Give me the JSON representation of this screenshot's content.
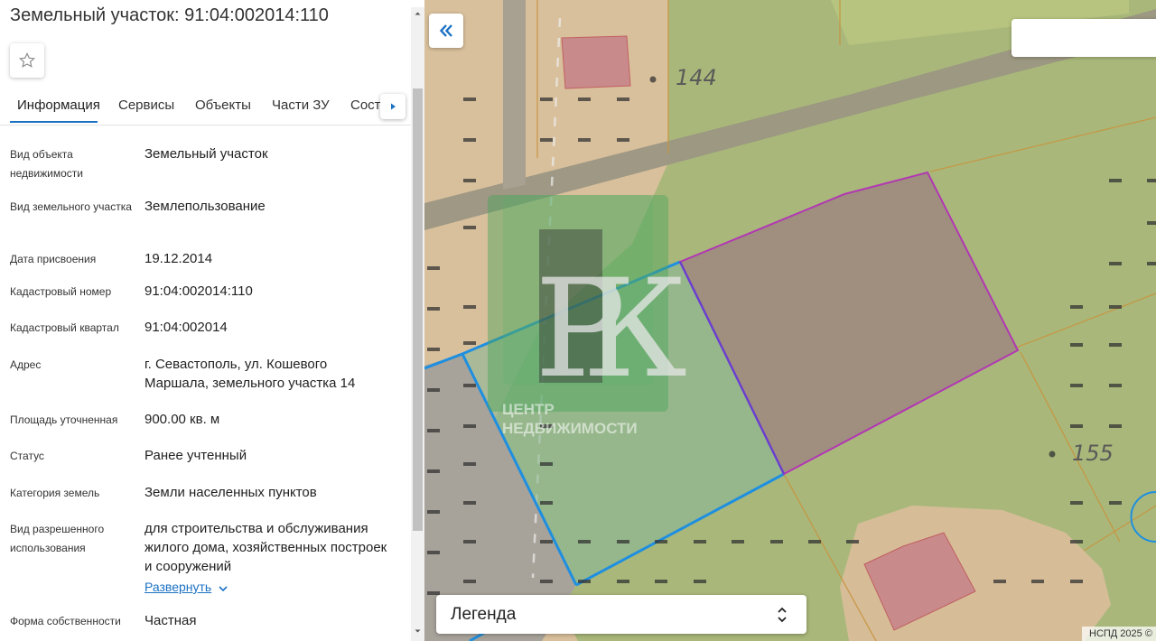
{
  "panel": {
    "title": "Земельный участок: 91:04:002014:110",
    "tabs": [
      {
        "label": "Информация",
        "active": true
      },
      {
        "label": "Сервисы",
        "active": false
      },
      {
        "label": "Объекты",
        "active": false
      },
      {
        "label": "Части ЗУ",
        "active": false
      },
      {
        "label": "Соста",
        "active": false
      }
    ],
    "fields": [
      {
        "label": "Вид объекта недвижимости",
        "value": "Земельный участок"
      },
      {
        "label": "Вид земельного участка",
        "value": "Землепользование"
      },
      {
        "label": "Дата присвоения",
        "value": "19.12.2014"
      },
      {
        "label": "Кадастровый номер",
        "value": "91:04:002014:110"
      },
      {
        "label": "Кадастровый квартал",
        "value": "91:04:002014"
      },
      {
        "label": "Адрес",
        "value": "г. Севастополь, ул. Кошевого Маршала, земельного участка 14"
      },
      {
        "label": "Площадь уточненная",
        "value": "900.00 кв. м"
      },
      {
        "label": "Статус",
        "value": "Ранее учтенный"
      },
      {
        "label": "Категория земель",
        "value": "Земли населенных пунктов"
      },
      {
        "label": "Вид разрешенного использования",
        "value": "для строительства и обслуживания жилого дома, хозяйственных построек и сооружений"
      },
      {
        "label": "Форма собственности",
        "value": "Частная"
      }
    ],
    "expand_label": "Развернуть"
  },
  "map": {
    "labels": [
      "144",
      "155"
    ],
    "legend_label": "Легенда",
    "copyright": "НСПД 2025 ©",
    "watermark": {
      "letters": "РК",
      "line1": "ЦЕНТР",
      "line2": "НЕДВИЖИМОСТИ"
    },
    "colors": {
      "terrain": "#d9c09c",
      "green_zone": "#a9b87a",
      "road": "#9b9683",
      "selected_parcel": "#a08e7e",
      "selected_border": "#b237b4",
      "neighbor_border": "#1e8fe0",
      "building": "#c98a8c"
    }
  }
}
